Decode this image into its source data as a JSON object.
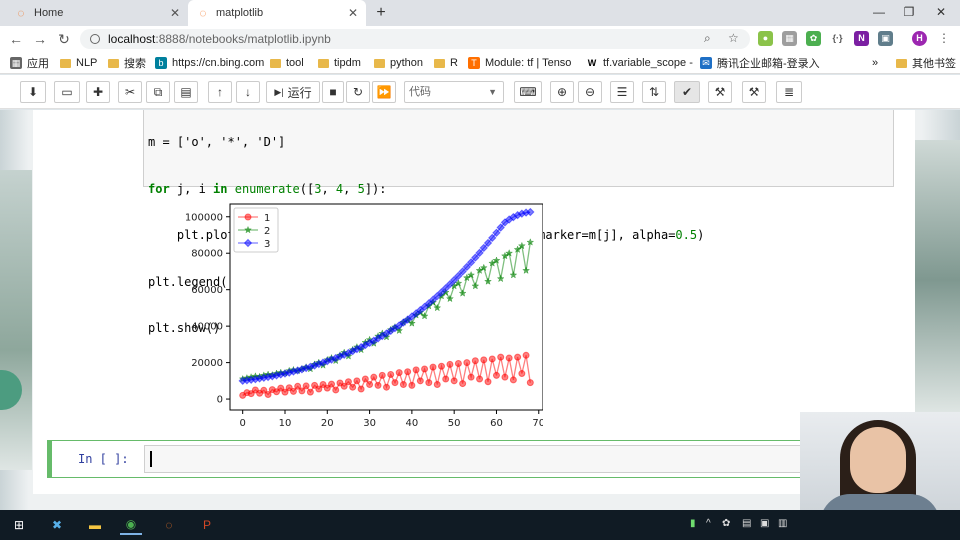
{
  "browser": {
    "tabs": [
      {
        "label": "Home",
        "icon": "jupyter-icon"
      },
      {
        "label": "matplotlib",
        "icon": "jupyter-icon"
      }
    ],
    "url_host": "localhost",
    "url_path": ":8888/notebooks/matplotlib.ipynb",
    "profile_initial": "H"
  },
  "bookmarks": {
    "apps": "应用",
    "items": [
      "NLP",
      "搜索",
      "https://cn.bing.com",
      "tool",
      "tipdm",
      "python",
      "R",
      "Module: tf | Tenso",
      "tf.variable_scope -",
      "腾讯企业邮箱-登录入"
    ],
    "more": "»",
    "other": "其他书签"
  },
  "jupyter": {
    "run_label": "运行",
    "cell_type": "代码",
    "code_lines": [
      "m = ['o', '*', 'D']",
      "for j, i in enumerate([3, 4, 5]):",
      "    plt.plot(range(69), data['values'][:, i], c=l[j], marker=m[j], alpha=0.5)",
      "plt.legend(['1', '2', '3'])",
      "plt.show()"
    ],
    "empty_prompt": "In  [  ]:"
  },
  "chart_data": {
    "type": "line",
    "xlim": [
      -3,
      71
    ],
    "ylim": [
      -6000,
      107000
    ],
    "xticks": [
      0,
      10,
      20,
      30,
      40,
      50,
      60,
      70
    ],
    "yticks": [
      0,
      20000,
      40000,
      60000,
      80000,
      100000
    ],
    "legend_position": "top-left",
    "grid": false,
    "x": [
      0,
      1,
      2,
      3,
      4,
      5,
      6,
      7,
      8,
      9,
      10,
      11,
      12,
      13,
      14,
      15,
      16,
      17,
      18,
      19,
      20,
      21,
      22,
      23,
      24,
      25,
      26,
      27,
      28,
      29,
      30,
      31,
      32,
      33,
      34,
      35,
      36,
      37,
      38,
      39,
      40,
      41,
      42,
      43,
      44,
      45,
      46,
      47,
      48,
      49,
      50,
      51,
      52,
      53,
      54,
      55,
      56,
      57,
      58,
      59,
      60,
      61,
      62,
      63,
      64,
      65,
      66,
      67,
      68
    ],
    "series": [
      {
        "name": "1",
        "color": "#ff0000",
        "marker": "o",
        "values": [
          2000,
          3500,
          3000,
          5000,
          3200,
          4800,
          2500,
          5200,
          4000,
          6000,
          3800,
          6200,
          4200,
          7000,
          4500,
          7200,
          3800,
          7500,
          5500,
          8000,
          6000,
          8200,
          5000,
          8800,
          7000,
          9500,
          6500,
          10000,
          5500,
          11000,
          8000,
          12000,
          7500,
          13000,
          6500,
          13500,
          9000,
          14500,
          8000,
          15000,
          7500,
          16000,
          10000,
          16500,
          9000,
          17500,
          8000,
          18000,
          11000,
          19000,
          10000,
          19500,
          8500,
          20000,
          12000,
          21000,
          11000,
          21500,
          9500,
          22000,
          13000,
          23000,
          12000,
          22500,
          10500,
          23000,
          14000,
          24000,
          9000
        ]
      },
      {
        "name": "2",
        "color": "#008000",
        "marker": "*",
        "values": [
          11000,
          11500,
          12000,
          12500,
          12200,
          13000,
          13500,
          13200,
          14000,
          14500,
          14200,
          15500,
          16000,
          15500,
          16500,
          17500,
          16500,
          19000,
          20000,
          18500,
          21500,
          22500,
          21000,
          24000,
          25500,
          23500,
          27000,
          28500,
          27000,
          31000,
          32500,
          30500,
          34500,
          36000,
          34000,
          38000,
          39500,
          37500,
          42000,
          43500,
          41500,
          46000,
          47500,
          45500,
          51000,
          53000,
          50000,
          56500,
          58500,
          55000,
          62000,
          63500,
          58000,
          66500,
          68000,
          62000,
          70500,
          72000,
          64500,
          74500,
          76000,
          66000,
          78500,
          80000,
          68000,
          82000,
          84000,
          70500,
          86000
        ]
      },
      {
        "name": "3",
        "color": "#0000ff",
        "marker": "D",
        "values": [
          10000,
          10300,
          10600,
          10900,
          11300,
          11700,
          12100,
          12500,
          13000,
          13500,
          14000,
          14500,
          15100,
          15700,
          16300,
          17000,
          17700,
          18400,
          19200,
          20000,
          20800,
          21600,
          22500,
          23400,
          24300,
          25300,
          26300,
          27400,
          28500,
          29600,
          30800,
          32000,
          33300,
          34600,
          36000,
          37400,
          38900,
          40400,
          42000,
          43600,
          45300,
          47000,
          48800,
          50600,
          52500,
          54500,
          56500,
          58600,
          60800,
          63000,
          65300,
          67600,
          70000,
          72500,
          75000,
          77600,
          80200,
          82900,
          85600,
          88400,
          91200,
          94100,
          96900,
          98500,
          99800,
          100900,
          101700,
          102300,
          102600
        ]
      }
    ]
  }
}
